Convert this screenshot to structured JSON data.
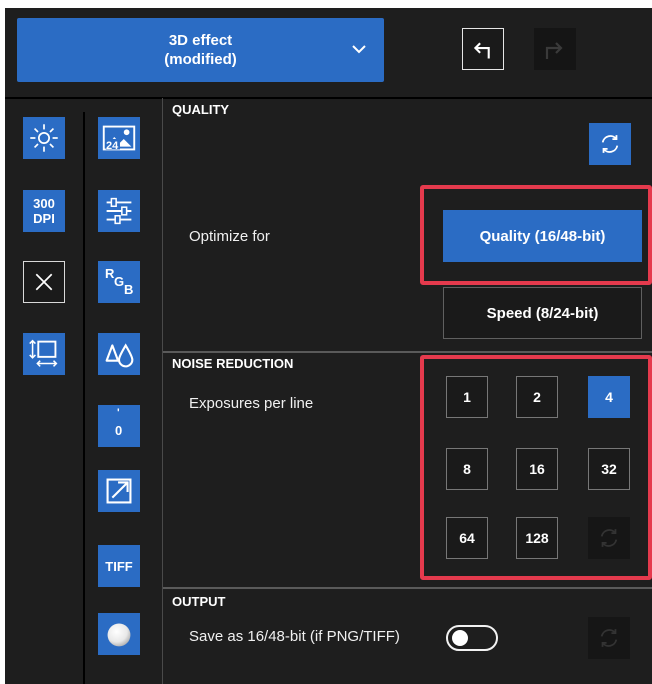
{
  "header": {
    "preset_line1": "3D effect",
    "preset_line2": "(modified)",
    "preset_icon": "chevron-down-icon",
    "undo_icon": "undo-icon",
    "redo_icon": "redo-icon"
  },
  "tools": {
    "col1": [
      {
        "name": "brightness-tool",
        "icon": "sun-icon"
      },
      {
        "name": "dpi-tool",
        "line1": "300",
        "line2": "DPI"
      },
      {
        "name": "close-tool",
        "icon": "close-icon"
      },
      {
        "name": "resize-tool",
        "icon": "resize-icon"
      }
    ],
    "col2": [
      {
        "name": "color-depth-tool",
        "badge": "24"
      },
      {
        "name": "adjust-tool",
        "icon": "sliders-icon"
      },
      {
        "name": "rgb-tool",
        "r": "R",
        "g": "G",
        "b": "B"
      },
      {
        "name": "drops-tool",
        "icon": "drops-icon"
      },
      {
        "name": "offset-tool",
        "mark": "'",
        "value": "0"
      },
      {
        "name": "expand-tool",
        "icon": "expand-icon"
      },
      {
        "name": "tiff-tool",
        "label": "TIFF"
      },
      {
        "name": "sphere-tool",
        "icon": "sphere-icon"
      }
    ]
  },
  "quality": {
    "title": "QUALITY",
    "optimize_label": "Optimize for",
    "quality_button": "Quality (16/48-bit)",
    "speed_button": "Speed (8/24-bit)",
    "selected": "Quality (16/48-bit)"
  },
  "noise": {
    "title": "NOISE REDUCTION",
    "exposures_label": "Exposures per line",
    "options": [
      "1",
      "2",
      "4",
      "8",
      "16",
      "32",
      "64",
      "128"
    ],
    "selected": "4"
  },
  "output": {
    "title": "OUTPUT",
    "save_label": "Save as 16/48-bit (if PNG/TIFF)",
    "toggle_on": false
  },
  "colors": {
    "accent": "#2b6cc4",
    "highlight": "#e53a4d",
    "background": "#1e1e1e"
  }
}
